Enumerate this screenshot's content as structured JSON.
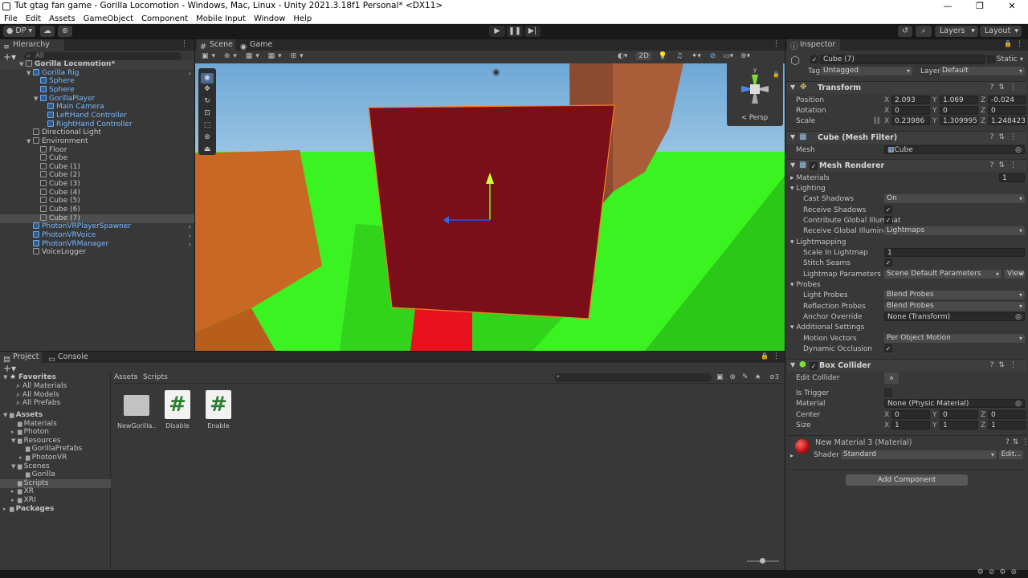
{
  "window": {
    "title": "Tut gtag fan game - Gorilla Locomotion - Windows, Mac, Linux - Unity 2021.3.18f1 Personal* <DX11>",
    "controls": [
      "—",
      "❐",
      "✕"
    ]
  },
  "menu": [
    "File",
    "Edit",
    "Assets",
    "GameObject",
    "Component",
    "Mobile Input",
    "Window",
    "Help"
  ],
  "toolbar": {
    "account": "DP",
    "layers": "Layers",
    "layout": "Layout"
  },
  "hierarchy": {
    "tab": "Hierarchy",
    "search_placeholder": "All",
    "items": [
      {
        "label": "Gorilla Locomotion*",
        "indent": 0,
        "type": "scene"
      },
      {
        "label": "Gorilla Rig",
        "indent": 1,
        "type": "prefab"
      },
      {
        "label": "Sphere",
        "indent": 2,
        "type": "prefab"
      },
      {
        "label": "Sphere",
        "indent": 2,
        "type": "prefab"
      },
      {
        "label": "GorillaPlayer",
        "indent": 2,
        "type": "prefab"
      },
      {
        "label": "Main Camera",
        "indent": 3,
        "type": "prefab"
      },
      {
        "label": "LeftHand Controller",
        "indent": 3,
        "type": "prefab"
      },
      {
        "label": "RightHand Controller",
        "indent": 3,
        "type": "prefab"
      },
      {
        "label": "Directional Light",
        "indent": 1,
        "type": "object"
      },
      {
        "label": "Environment",
        "indent": 1,
        "type": "object"
      },
      {
        "label": "Floor",
        "indent": 2,
        "type": "object"
      },
      {
        "label": "Cube",
        "indent": 2,
        "type": "object"
      },
      {
        "label": "Cube (1)",
        "indent": 2,
        "type": "object"
      },
      {
        "label": "Cube (2)",
        "indent": 2,
        "type": "object"
      },
      {
        "label": "Cube (3)",
        "indent": 2,
        "type": "object"
      },
      {
        "label": "Cube (4)",
        "indent": 2,
        "type": "object"
      },
      {
        "label": "Cube (5)",
        "indent": 2,
        "type": "object"
      },
      {
        "label": "Cube (6)",
        "indent": 2,
        "type": "object"
      },
      {
        "label": "Cube (7)",
        "indent": 2,
        "type": "object"
      },
      {
        "label": "PhotonVRPlayerSpawner",
        "indent": 1,
        "type": "prefab"
      },
      {
        "label": "PhotonVRVoice",
        "indent": 1,
        "type": "prefab"
      },
      {
        "label": "PhotonVRManager",
        "indent": 1,
        "type": "prefab"
      },
      {
        "label": "VoiceLogger",
        "indent": 1,
        "type": "object"
      }
    ]
  },
  "scene": {
    "tabs": [
      "Scene",
      "Game"
    ],
    "toolbar_2d": "2D",
    "persp_label": "< Persp",
    "gizmo_y": "y",
    "colors": {
      "sky": "#7fb4d9",
      "ground": "#3bf321",
      "selected_cube": "#7a0f1a",
      "orange_wall": "#c86822",
      "brown_wall": "#8a4b30",
      "red_block": "#e8121f"
    }
  },
  "project": {
    "tabs": [
      "Project",
      "Console"
    ],
    "breadcrumb": [
      "Assets",
      "Scripts"
    ],
    "favorites_label": "Favorites",
    "favorites": [
      "All Materials",
      "All Models",
      "All Prefabs"
    ],
    "tree": [
      {
        "label": "Assets",
        "indent": 0,
        "bold": true
      },
      {
        "label": "Materials",
        "indent": 1
      },
      {
        "label": "Photon",
        "indent": 1
      },
      {
        "label": "Resources",
        "indent": 1
      },
      {
        "label": "GorillaPrefabs",
        "indent": 2
      },
      {
        "label": "PhotonVR",
        "indent": 2
      },
      {
        "label": "Scenes",
        "indent": 1
      },
      {
        "label": "Gorilla",
        "indent": 2
      },
      {
        "label": "Scripts",
        "indent": 1
      },
      {
        "label": "XR",
        "indent": 1
      },
      {
        "label": "XRI",
        "indent": 1
      },
      {
        "label": "Packages",
        "indent": 0,
        "bold": true
      }
    ],
    "assets": [
      {
        "label": "NewGorilla...",
        "kind": "folder"
      },
      {
        "label": "Disable",
        "kind": "script"
      },
      {
        "label": "Enable",
        "kind": "script"
      }
    ],
    "badge_count": "3"
  },
  "inspector": {
    "tab": "Inspector",
    "object_name": "Cube (7)",
    "static_label": "Static",
    "tag_label": "Tag",
    "tag_value": "Untagged",
    "layer_label": "Layer",
    "layer_value": "Default",
    "transform": {
      "title": "Transform",
      "position_label": "Position",
      "position": [
        "2.093",
        "1.069",
        "-0.024"
      ],
      "rotation_label": "Rotation",
      "rotation": [
        "0",
        "0",
        "0"
      ],
      "scale_label": "Scale",
      "scale": [
        "0.23986",
        "1.309995",
        "1.248423"
      ]
    },
    "mesh_filter": {
      "title": "Cube (Mesh Filter)",
      "mesh_label": "Mesh",
      "mesh_value": "Cube"
    },
    "mesh_renderer": {
      "title": "Mesh Renderer",
      "materials_label": "Materials",
      "materials_count": "1",
      "lighting_label": "Lighting",
      "cast_shadows_label": "Cast Shadows",
      "cast_shadows": "On",
      "receive_shadows_label": "Receive Shadows",
      "contribute_gi_label": "Contribute Global Illuminat",
      "receive_gi_label": "Receive Global Illuminatio",
      "receive_gi": "Lightmaps",
      "lightmapping_label": "Lightmapping",
      "scale_in_lightmap_label": "Scale In Lightmap",
      "scale_in_lightmap": "1",
      "stitch_seams_label": "Stitch Seams",
      "lightmap_params_label": "Lightmap Parameters",
      "lightmap_params": "Scene Default Parameters",
      "view_label": "View",
      "probes_label": "Probes",
      "light_probes_label": "Light Probes",
      "light_probes": "Blend Probes",
      "reflection_probes_label": "Reflection Probes",
      "reflection_probes": "Blend Probes",
      "anchor_override_label": "Anchor Override",
      "anchor_override": "None (Transform)",
      "additional_label": "Additional Settings",
      "motion_vectors_label": "Motion Vectors",
      "motion_vectors": "Per Object Motion",
      "dynamic_occlusion_label": "Dynamic Occlusion"
    },
    "box_collider": {
      "title": "Box Collider",
      "edit_collider_label": "Edit Collider",
      "is_trigger_label": "Is Trigger",
      "material_label": "Material",
      "material_value": "None (Physic Material)",
      "center_label": "Center",
      "center": [
        "0",
        "0",
        "0"
      ],
      "size_label": "Size",
      "size": [
        "1",
        "1",
        "1"
      ]
    },
    "material": {
      "title": "New Material 3 (Material)",
      "shader_label": "Shader",
      "shader_value": "Standard",
      "edit_label": "Edit..."
    },
    "add_component": "Add Component"
  }
}
